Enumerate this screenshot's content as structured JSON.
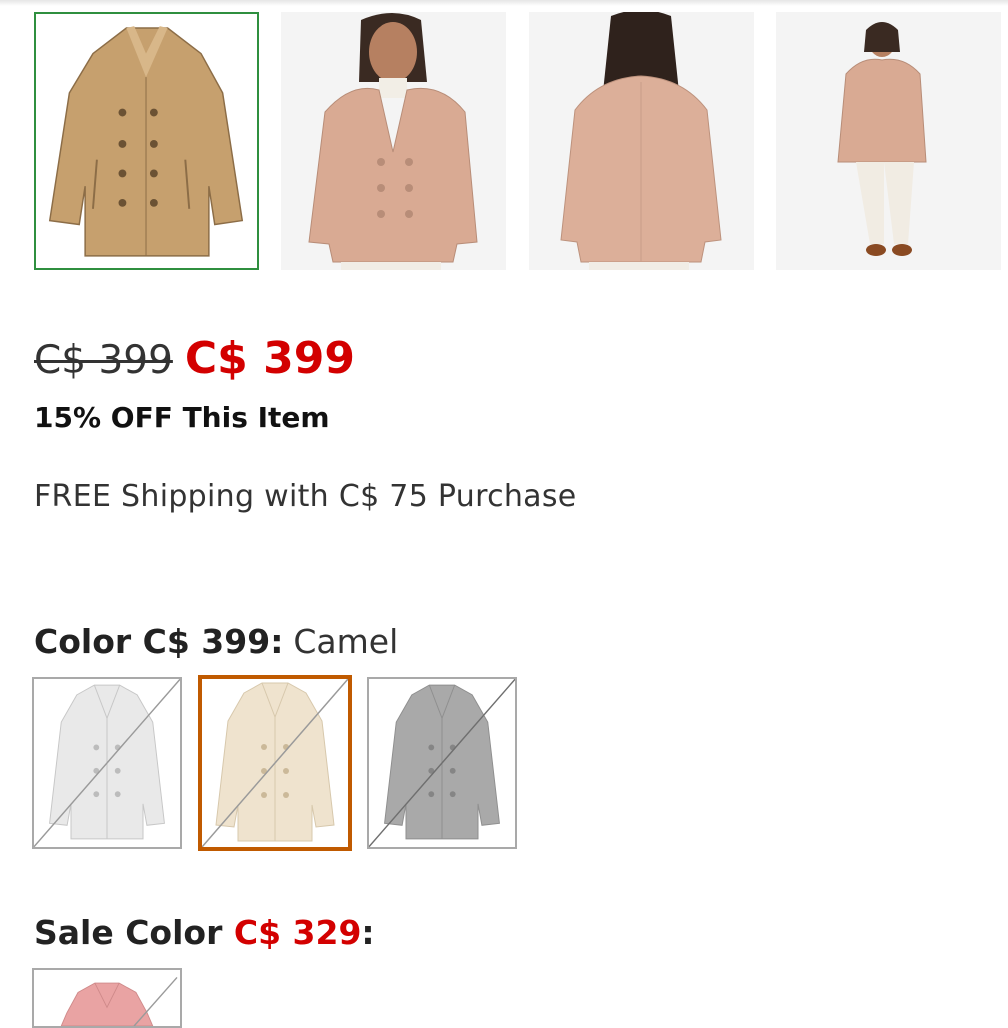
{
  "gallery": {
    "thumbnails": [
      {
        "name": "product-flat",
        "selected": true
      },
      {
        "name": "model-front",
        "selected": false
      },
      {
        "name": "model-back",
        "selected": false
      },
      {
        "name": "model-full",
        "selected": false
      }
    ],
    "accent_color": "#2f8f3f"
  },
  "price": {
    "original": "C$ 399",
    "current": "C$ 399",
    "discount_text": "15% OFF This Item",
    "shipping_text": "FREE Shipping with C$ 75 Purchase",
    "sale_color": "#d30000"
  },
  "color_section": {
    "label": "Color C$ 399:",
    "selected_value": "Camel",
    "swatches": [
      {
        "name": "light-gray",
        "unavailable": true,
        "selected": false
      },
      {
        "name": "camel",
        "unavailable": true,
        "selected": true
      },
      {
        "name": "charcoal",
        "unavailable": true,
        "selected": false
      }
    ],
    "selected_border_color": "#c05a00"
  },
  "sale_section": {
    "label": "Sale Color ",
    "price": "C$ 329",
    "suffix": ":",
    "swatches": [
      {
        "name": "red",
        "unavailable": true
      }
    ]
  }
}
